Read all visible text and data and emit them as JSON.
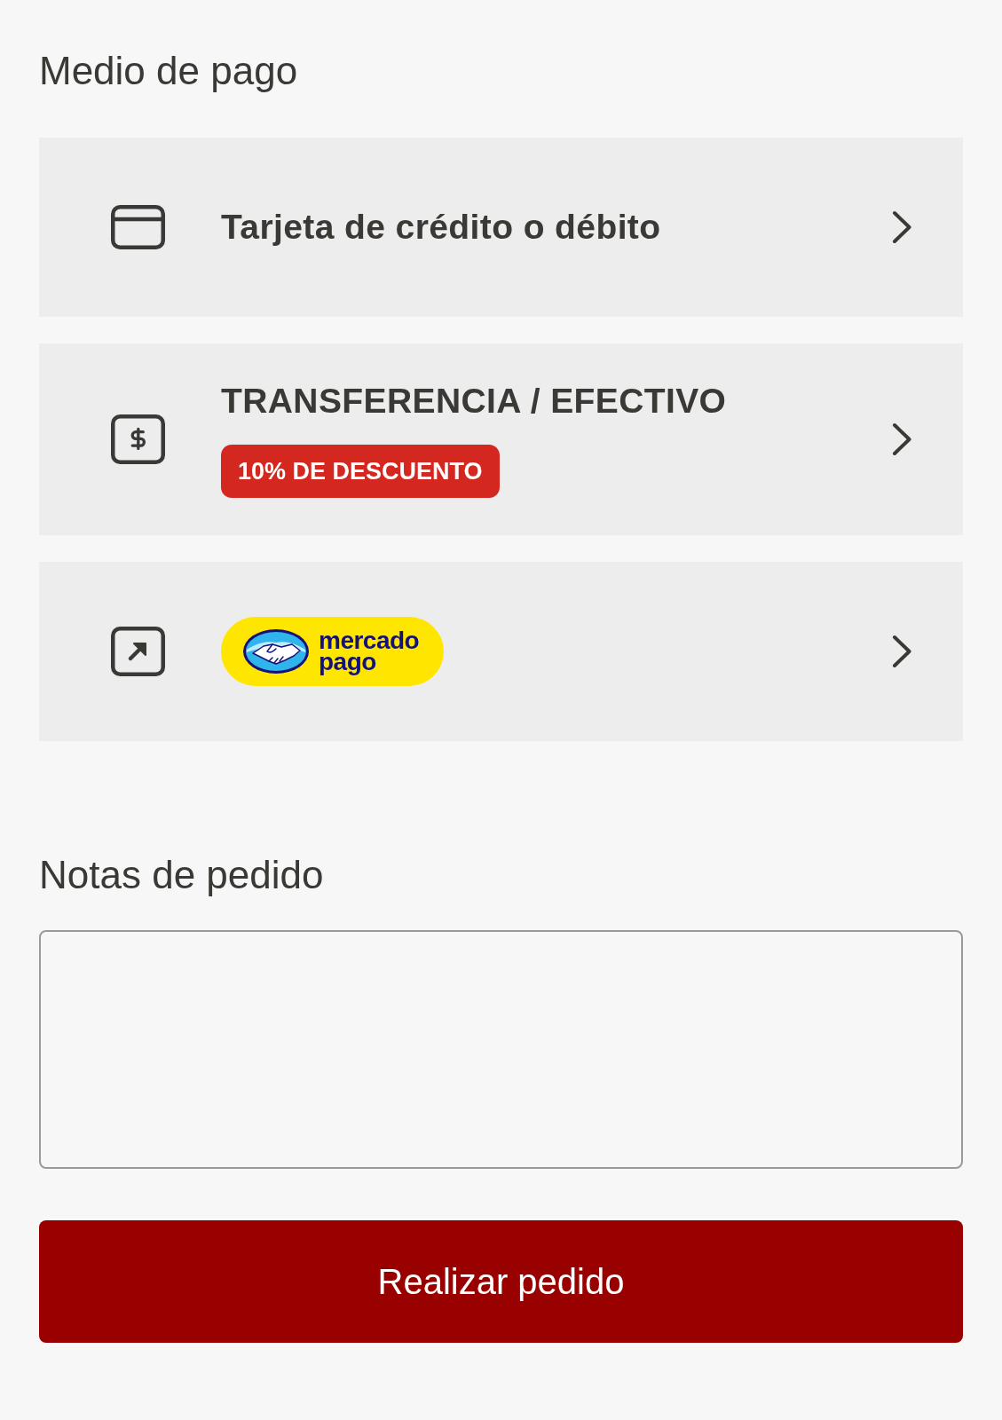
{
  "payment_section": {
    "title": "Medio de pago"
  },
  "payment_methods": [
    {
      "kind": "card",
      "title": "Tarjeta de crédito o débito"
    },
    {
      "kind": "cash",
      "title": "TRANSFERENCIA / EFECTIVO",
      "badge": "10% DE DESCUENTO"
    },
    {
      "kind": "external",
      "logo_text": "mercado pago"
    }
  ],
  "notes": {
    "label": "Notas de pedido"
  },
  "submit_button": {
    "label": "Realizar pedido"
  }
}
